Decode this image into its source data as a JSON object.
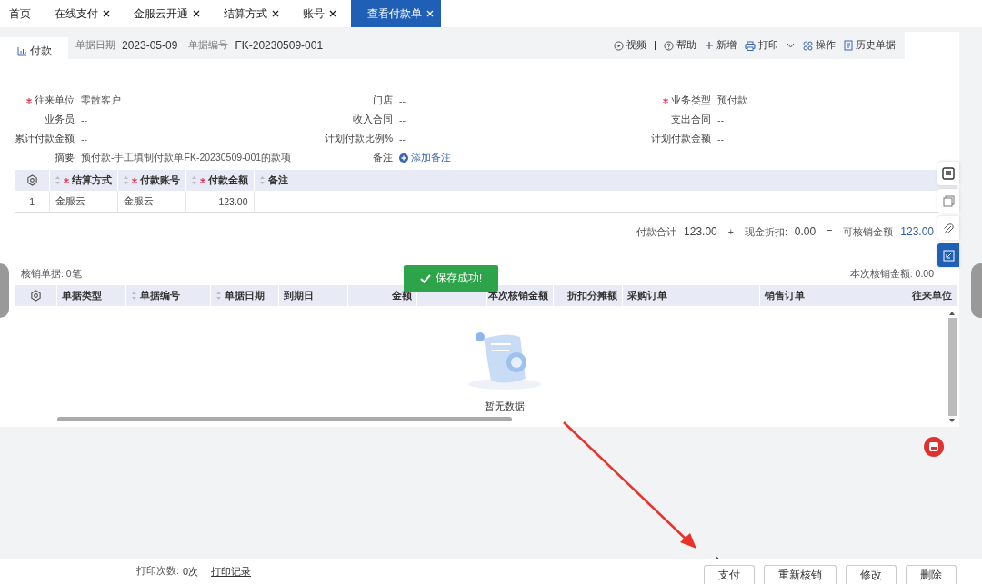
{
  "tabs": [
    {
      "label": "首页",
      "closable": false,
      "selected": false
    },
    {
      "label": "在线支付",
      "closable": true,
      "selected": false
    },
    {
      "label": "金服云开通",
      "closable": true,
      "selected": false
    },
    {
      "label": "结算方式",
      "closable": true,
      "selected": false
    },
    {
      "label": "账号",
      "closable": true,
      "selected": false
    },
    {
      "label": "查看付款单",
      "closable": true,
      "selected": true
    }
  ],
  "doc_header": {
    "type_tab": "付款",
    "fields": [
      {
        "label": "单据日期",
        "value": "2023-05-09"
      },
      {
        "label": "单据编号",
        "value": "FK-20230509-001"
      }
    ]
  },
  "toolbar": [
    {
      "kind": "video",
      "label": "视频"
    },
    {
      "kind": "help",
      "label": "帮助"
    },
    {
      "kind": "add",
      "label": "新增"
    },
    {
      "kind": "print",
      "label": "打印"
    },
    {
      "kind": "ops",
      "label": "操作"
    },
    {
      "kind": "history",
      "label": "历史单据"
    }
  ],
  "form": [
    [
      {
        "label": "往来单位",
        "required": true,
        "value": "零散客户"
      },
      {
        "label": "门店",
        "required": false,
        "value": "--"
      },
      {
        "label": "业务类型",
        "required": true,
        "value": "预付款"
      }
    ],
    [
      {
        "label": "业务员",
        "required": false,
        "value": "--"
      },
      {
        "label": "收入合同",
        "required": false,
        "value": "--"
      },
      {
        "label": "支出合同",
        "required": false,
        "value": "--"
      }
    ],
    [
      {
        "label": "累计付款金额",
        "required": false,
        "value": "--"
      },
      {
        "label": "计划付款比例%",
        "required": false,
        "value": "--"
      },
      {
        "label": "计划付款金额",
        "required": false,
        "value": "--"
      }
    ],
    [
      {
        "label": "摘要",
        "required": false,
        "value": "预付款-手工填制付款单FK-20230509-001的款项"
      },
      {
        "label": "备注",
        "required": false,
        "kind": "link",
        "value": "添加备注"
      }
    ]
  ],
  "payment_table": {
    "columns": [
      {
        "kind": "settings"
      },
      {
        "kind": "text",
        "label": "结算方式",
        "required": true,
        "sortable": true
      },
      {
        "kind": "text",
        "label": "付款账号",
        "required": true,
        "sortable": true
      },
      {
        "kind": "text",
        "label": "付款金额",
        "required": true,
        "sortable": true
      },
      {
        "kind": "text",
        "label": "备注",
        "required": false,
        "sortable": true
      }
    ],
    "rows": [
      [
        "1",
        "金服云",
        "金服云",
        "123.00"
      ]
    ]
  },
  "totals": [
    {
      "kind": "term",
      "label": "付款合计",
      "value": "123.00",
      "highlight": false
    },
    {
      "kind": "operator",
      "label": "+"
    },
    {
      "kind": "term",
      "label": "现金折扣:",
      "value": "0.00",
      "highlight": false
    },
    {
      "kind": "operator",
      "label": "="
    },
    {
      "kind": "term",
      "label": "可核销金额",
      "value": "123.00",
      "highlight": true
    }
  ],
  "writeoff": {
    "count_label": "核销单据: 0笔",
    "amount_label": "本次核销金额: 0.00",
    "columns": [
      {
        "kind": "settings"
      },
      {
        "kind": "text",
        "label": "单据类型",
        "sortable": false
      },
      {
        "kind": "text",
        "label": "单据编号",
        "sortable": true
      },
      {
        "kind": "text",
        "label": "单据日期",
        "sortable": true
      },
      {
        "kind": "text",
        "label": "到期日",
        "sortable": false
      },
      {
        "kind": "text",
        "label": "金额",
        "sortable": false
      },
      {
        "kind": "hidden"
      },
      {
        "kind": "text",
        "label": "本次核销金额",
        "sortable": false
      },
      {
        "kind": "text",
        "label": "折扣分摊额",
        "sortable": false
      },
      {
        "kind": "text",
        "label": "采购订单",
        "sortable": false
      },
      {
        "kind": "text",
        "label": "销售订单",
        "sortable": false
      },
      {
        "kind": "text",
        "label": "往来单位",
        "sortable": false
      }
    ],
    "empty_text": "暂无数据"
  },
  "toast": {
    "text": "保存成功!"
  },
  "footer": {
    "print_count_label": "打印次数:",
    "print_count": "0次",
    "print_log_link": "打印记录",
    "buttons": [
      "支付",
      "重新核销",
      "修改",
      "删除"
    ]
  }
}
